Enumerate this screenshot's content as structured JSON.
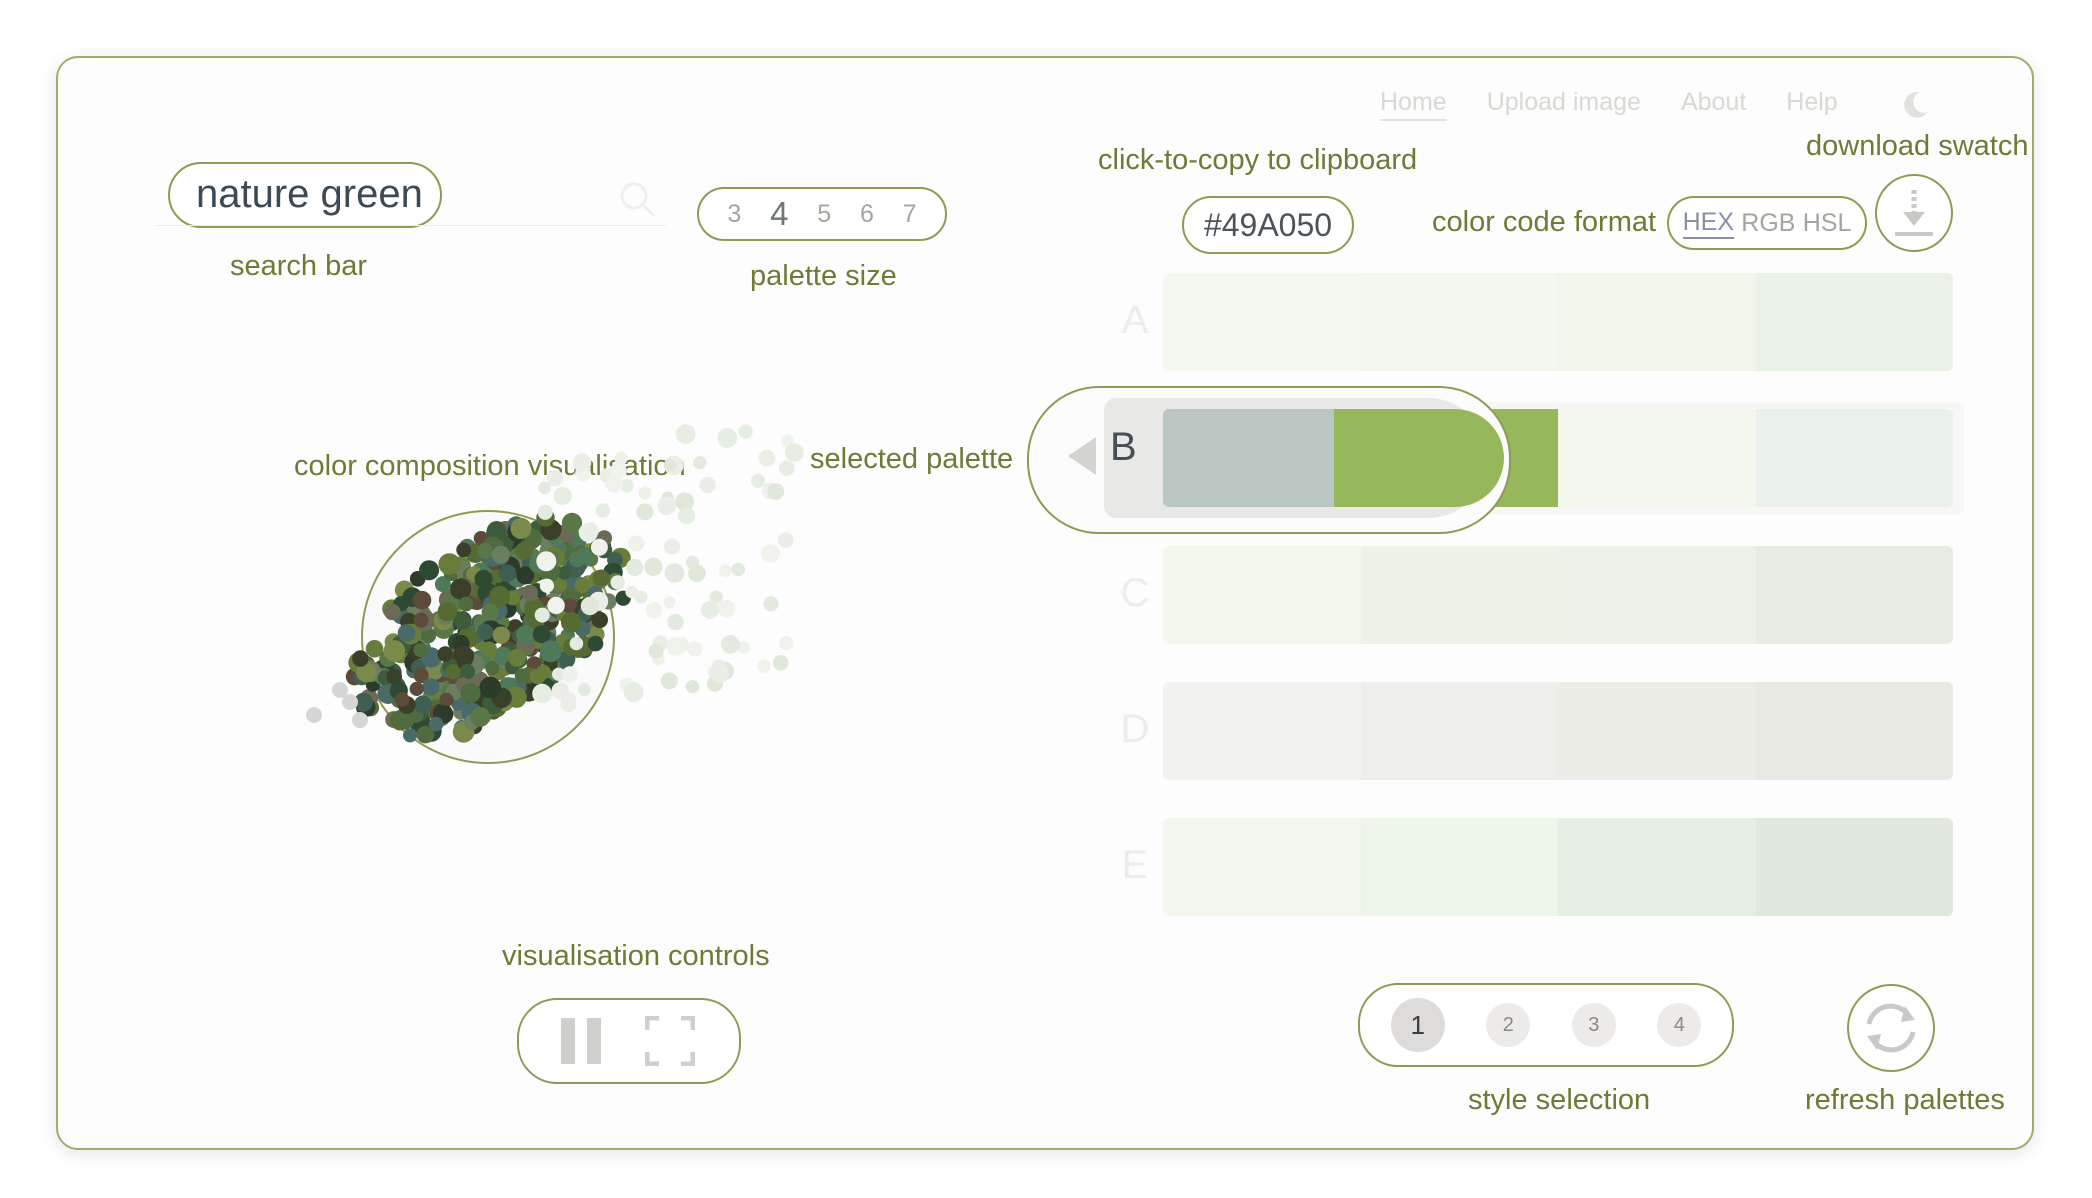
{
  "nav": {
    "items": [
      "Home",
      "Upload image",
      "About",
      "Help"
    ],
    "active": "Home",
    "theme_icon": "moon-icon"
  },
  "search": {
    "value": "nature green",
    "icon": "search-icon",
    "annotation": "search bar"
  },
  "palette_size": {
    "options": [
      "3",
      "4",
      "5",
      "6",
      "7"
    ],
    "selected": "4",
    "annotation": "palette size"
  },
  "clipboard": {
    "annotation": "click-to-copy to clipboard",
    "value": "#49A050"
  },
  "color_format": {
    "annotation": "color code format",
    "options": [
      "HEX",
      "RGB",
      "HSL"
    ],
    "selected": "HEX"
  },
  "download": {
    "annotation": "download swatch",
    "icon": "download-icon"
  },
  "visualisation": {
    "annotation": "color composition visualisation"
  },
  "selected_palette": {
    "annotation": "selected palette"
  },
  "palettes": [
    {
      "label": "A",
      "colors": [
        "#f4f8f1",
        "#f4f7ef",
        "#f2f6ea",
        "#eaf1e6"
      ]
    },
    {
      "label": "B",
      "colors": [
        "#bac6c2",
        "#96b75c",
        "#f4f7ee",
        "#eaf0ec"
      ]
    },
    {
      "label": "C",
      "colors": [
        "#f4f8ec",
        "#eef3e8",
        "#edf1e8",
        "#e7ece3"
      ]
    },
    {
      "label": "D",
      "colors": [
        "#f2f2ee",
        "#eeefea",
        "#ecede7",
        "#e8e9e3"
      ]
    },
    {
      "label": "E",
      "colors": [
        "#f3f7f0",
        "#eef6e9",
        "#e6efe3",
        "#e1e8dd"
      ]
    }
  ],
  "viz_controls": {
    "annotation": "visualisation controls",
    "pause_icon": "pause-icon",
    "fullscreen_icon": "fullscreen-icon"
  },
  "style_selection": {
    "annotation": "style selection",
    "options": [
      "1",
      "2",
      "3",
      "4"
    ],
    "selected": "1"
  },
  "refresh": {
    "annotation": "refresh palettes",
    "icon": "refresh-icon"
  },
  "colors": {
    "accent_border": "#8f9a52",
    "annotation_text": "#6e7a36"
  }
}
